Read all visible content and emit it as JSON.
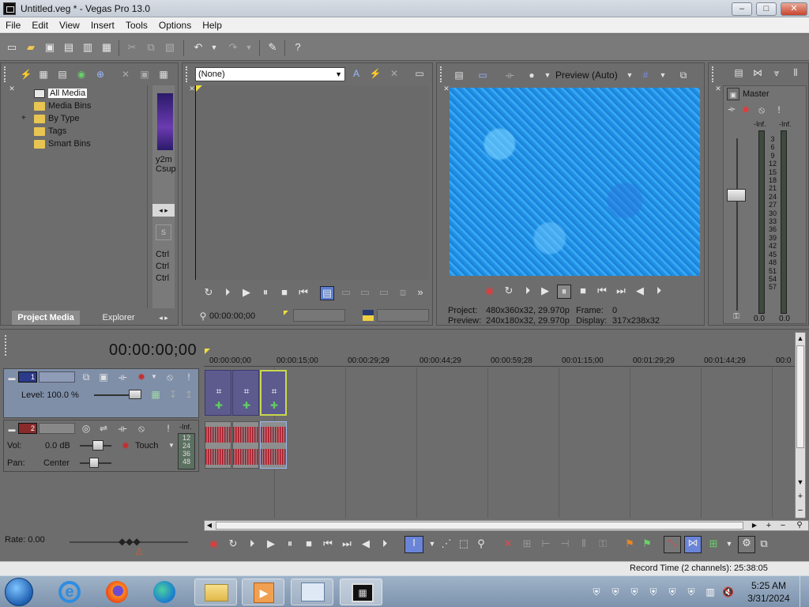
{
  "window": {
    "title": "Untitled.veg * - Vegas Pro 13.0",
    "controls": {
      "minimize": "‒",
      "maximize": "□",
      "close": "✕"
    }
  },
  "menu": [
    "File",
    "Edit",
    "View",
    "Insert",
    "Tools",
    "Options",
    "Help"
  ],
  "toolbar": {
    "icons": [
      "new-icon",
      "open-icon",
      "save-icon",
      "save-as-icon",
      "render-icon",
      "cut-icon",
      "copy-icon",
      "paste-icon",
      "undo-icon",
      "redo-icon",
      "edit-tool-icon",
      "whats-this-icon"
    ]
  },
  "project_media": {
    "tree": [
      {
        "label": "All Media",
        "selected": true,
        "expand": ""
      },
      {
        "label": "Media Bins",
        "selected": false,
        "expand": ""
      },
      {
        "label": "By Type",
        "selected": false,
        "expand": "+"
      },
      {
        "label": "Tags",
        "selected": false,
        "expand": ""
      },
      {
        "label": "Smart Bins",
        "selected": false,
        "expand": ""
      }
    ],
    "thumb_caption_1": "y2m",
    "thumb_caption_2": "Csup",
    "ctrl_lines": [
      "Ctrl",
      "Ctrl",
      "Ctrl"
    ],
    "tabs": [
      "Project Media",
      "Explorer"
    ],
    "active_tab": "Project Media"
  },
  "trimmer": {
    "combo_value": "(None)",
    "timecode": "00:00:00;00"
  },
  "preview": {
    "mode": "Preview (Auto)",
    "project_label": "Project:",
    "project_value": "480x360x32, 29.970p",
    "preview_label": "Preview:",
    "preview_value": "240x180x32, 29.970p",
    "frame_label": "Frame:",
    "frame_value": "0",
    "display_label": "Display:",
    "display_value": "317x238x32"
  },
  "mixer": {
    "master_label": "Master",
    "peak_left": "-Inf.",
    "peak_right": "-Inf.",
    "scale": [
      "3",
      "6",
      "9",
      "12",
      "15",
      "18",
      "21",
      "24",
      "27",
      "30",
      "33",
      "36",
      "39",
      "42",
      "45",
      "48",
      "51",
      "54",
      "57"
    ],
    "db_left": "0.0",
    "db_right": "0.0"
  },
  "timeline": {
    "cursor_time": "00:00:00;00",
    "ruler": [
      "00:00:00;00",
      "00:00:15;00",
      "00:00:29;29",
      "00:00:44;29",
      "00:00:59;28",
      "00:01:15;00",
      "00:01:29;29",
      "00:01:44;29",
      "00:0"
    ],
    "video_track": {
      "number": "1",
      "level_label": "Level: 100.0 %"
    },
    "audio_track": {
      "number": "2",
      "vol_label": "Vol:",
      "vol_value": "0.0 dB",
      "pan_label": "Pan:",
      "pan_value": "Center",
      "automation": "Touch",
      "peak": "-Inf.",
      "scale": [
        "12",
        "24",
        "36",
        "48"
      ]
    },
    "rate": "Rate: 0.00"
  },
  "status": {
    "record_time": "Record Time (2 channels): 25:38:05"
  },
  "taskbar": {
    "apps": [
      "start-orb-icon",
      "internet-explorer-icon",
      "firefox-icon",
      "edge-icon",
      "file-explorer-icon",
      "media-player-icon",
      "control-panel-icon",
      "vegas-pro-icon"
    ],
    "time": "5:25 AM",
    "date": "3/31/2024"
  },
  "colors": {
    "accent": "#4a6fd8",
    "record": "#e23c3c",
    "selection": "#7f8fa8"
  }
}
